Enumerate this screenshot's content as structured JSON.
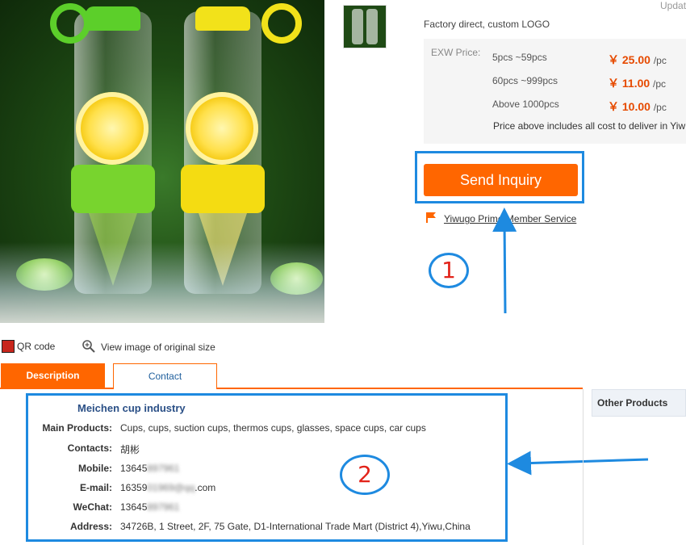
{
  "header": {
    "update_text": "Updat"
  },
  "product": {
    "factory_text": "Factory direct, custom LOGO",
    "exw_label": "EXW Price:",
    "price_tiers": [
      {
        "range": "5pcs ~59pcs",
        "price": "￥ 25.00",
        "unit": "/pc"
      },
      {
        "range": "60pcs ~999pcs",
        "price": "￥ 11.00",
        "unit": "/pc"
      },
      {
        "range": "Above 1000pcs",
        "price": "￥ 10.00",
        "unit": "/pc"
      }
    ],
    "price_note": "Price above includes all cost to deliver in Yiw",
    "send_inquiry": "Send Inquiry",
    "prime_service": "Yiwugo Prime Member Service"
  },
  "annotations": {
    "marker_1": "1",
    "marker_2": "2"
  },
  "image_tools": {
    "qr_code": "QR code",
    "view_original": "View image of original size"
  },
  "tabs": {
    "description": "Description",
    "contact": "Contact"
  },
  "sidebar": {
    "other_products": "Other Products"
  },
  "contact": {
    "company": "Meichen cup industry",
    "main_products_label": "Main Products:",
    "main_products": "Cups, cups, suction cups, thermos cups, glasses, space cups, car cups",
    "contacts_label": "Contacts:",
    "contacts": "胡彬",
    "mobile_label": "Mobile:",
    "mobile_visible": "13645",
    "mobile_blurred": "897961",
    "email_label": "E-mail:",
    "email_visible": "16359",
    "email_blurred": "01969@qq",
    "email_suffix": ".com",
    "wechat_label": "WeChat:",
    "wechat_visible": "13645",
    "wechat_blurred": "897961",
    "address_label": "Address:",
    "address": "34726B, 1 Street, 2F, 75 Gate, D1-International Trade Mart (District 4),Yiwu,China"
  },
  "colors": {
    "accent": "#ff6600",
    "annotation_blue": "#1e8ae0",
    "price": "#e64a00",
    "marker_red": "#e2231a"
  }
}
